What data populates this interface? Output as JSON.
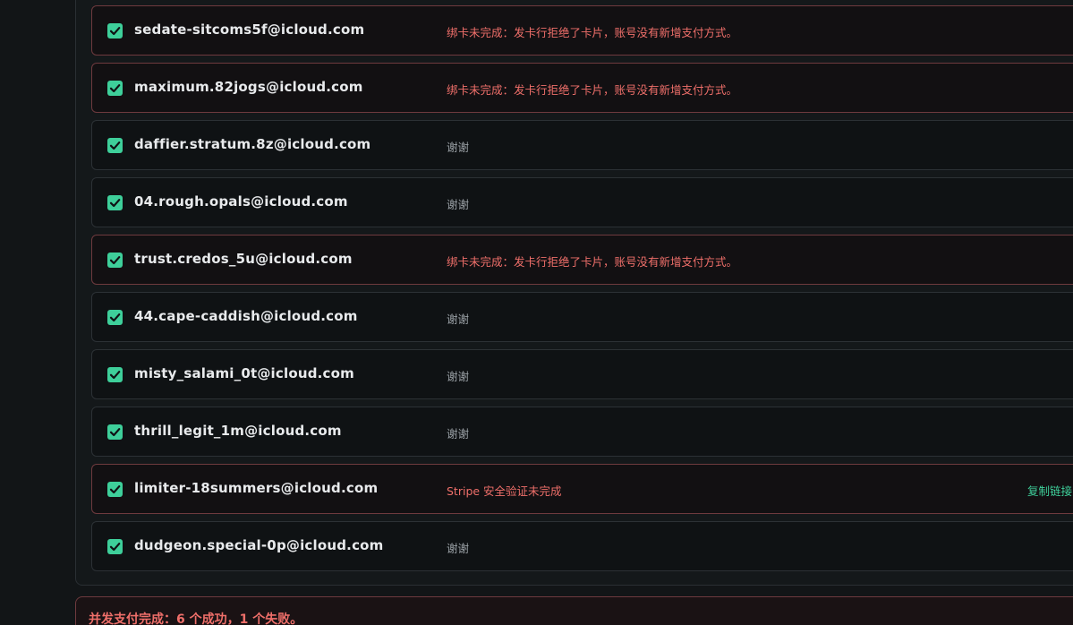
{
  "accounts": [
    {
      "email": "sedate-sitcoms5f@icloud.com",
      "status": "绑卡未完成：发卡行拒绝了卡片，账号没有新增支付方式。",
      "checked": true,
      "state": "failed"
    },
    {
      "email": "maximum.82jogs@icloud.com",
      "status": "绑卡未完成：发卡行拒绝了卡片，账号没有新增支付方式。",
      "checked": true,
      "state": "failed"
    },
    {
      "email": "daffier.stratum.8z@icloud.com",
      "status": "谢谢",
      "checked": true,
      "state": "ok"
    },
    {
      "email": "04.rough.opals@icloud.com",
      "status": "谢谢",
      "checked": true,
      "state": "ok"
    },
    {
      "email": "trust.credos_5u@icloud.com",
      "status": "绑卡未完成：发卡行拒绝了卡片，账号没有新增支付方式。",
      "checked": true,
      "state": "failed"
    },
    {
      "email": "44.cape-caddish@icloud.com",
      "status": "谢谢",
      "checked": true,
      "state": "ok"
    },
    {
      "email": "misty_salami_0t@icloud.com",
      "status": "谢谢",
      "checked": true,
      "state": "ok"
    },
    {
      "email": "thrill_legit_1m@icloud.com",
      "status": "谢谢",
      "checked": true,
      "state": "ok"
    },
    {
      "email": "limiter-18summers@icloud.com",
      "status": "Stripe 安全验证未完成",
      "checked": true,
      "state": "failed",
      "action": "复制链接"
    },
    {
      "email": "dudgeon.special-0p@icloud.com",
      "status": "谢谢",
      "checked": true,
      "state": "ok"
    }
  ],
  "summary": {
    "text": "并发支付完成：6 个成功，1 个失败。"
  },
  "colors": {
    "accent": "#3ecf9a",
    "error": "#ef6f6a",
    "background": "#121517"
  },
  "icons": {
    "checkbox": "checkbox-checked-icon"
  }
}
